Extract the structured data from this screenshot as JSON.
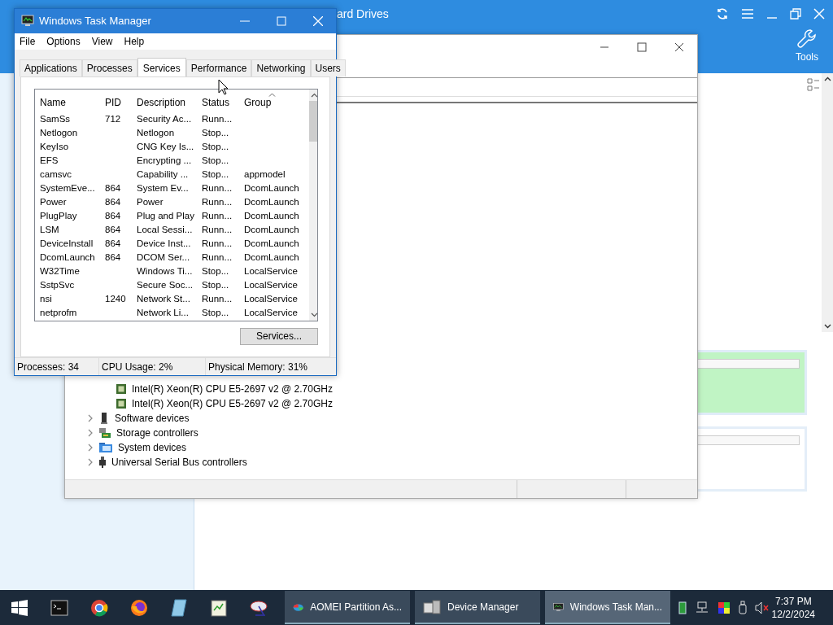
{
  "background_app": {
    "title": "ard Drives",
    "tools_label": "Tools"
  },
  "device_manager": {
    "tree": [
      {
        "kind": "cpu",
        "label": "Intel(R) Xeon(R) CPU E5-2697 v2 @ 2.70GHz"
      },
      {
        "kind": "cpu",
        "label": "Intel(R) Xeon(R) CPU E5-2697 v2 @ 2.70GHz"
      },
      {
        "kind": "software",
        "label": "Software devices",
        "expanded": false
      },
      {
        "kind": "storage",
        "label": "Storage controllers",
        "expanded": false
      },
      {
        "kind": "system",
        "label": "System devices",
        "expanded": false
      },
      {
        "kind": "usb",
        "label": "Universal Serial Bus controllers",
        "expanded": false
      }
    ]
  },
  "task_manager": {
    "title": "Windows Task Manager",
    "menu": [
      "File",
      "Options",
      "View",
      "Help"
    ],
    "tabs": [
      {
        "label": "Applications",
        "selected": false
      },
      {
        "label": "Processes",
        "selected": false
      },
      {
        "label": "Services",
        "selected": true
      },
      {
        "label": "Performance",
        "selected": false
      },
      {
        "label": "Networking",
        "selected": false
      },
      {
        "label": "Users",
        "selected": false
      }
    ],
    "columns": [
      {
        "label": "Name",
        "sorted": false
      },
      {
        "label": "PID",
        "sorted": false
      },
      {
        "label": "Description",
        "sorted": false
      },
      {
        "label": "Status",
        "sorted": false
      },
      {
        "label": "Group",
        "sorted": true
      }
    ],
    "rows": [
      [
        "SamSs",
        "712",
        "Security Ac...",
        "Runn...",
        ""
      ],
      [
        "Netlogon",
        "",
        "Netlogon",
        "Stop...",
        ""
      ],
      [
        "KeyIso",
        "",
        "CNG Key Is...",
        "Stop...",
        ""
      ],
      [
        "EFS",
        "",
        "Encrypting ...",
        "Stop...",
        ""
      ],
      [
        "camsvc",
        "",
        "Capability ...",
        "Stop...",
        "appmodel"
      ],
      [
        "SystemEve...",
        "864",
        "System Ev...",
        "Runn...",
        "DcomLaunch"
      ],
      [
        "Power",
        "864",
        "Power",
        "Runn...",
        "DcomLaunch"
      ],
      [
        "PlugPlay",
        "864",
        "Plug and Play",
        "Runn...",
        "DcomLaunch"
      ],
      [
        "LSM",
        "864",
        "Local Sessi...",
        "Runn...",
        "DcomLaunch"
      ],
      [
        "DeviceInstall",
        "864",
        "Device Inst...",
        "Runn...",
        "DcomLaunch"
      ],
      [
        "DcomLaunch",
        "864",
        "DCOM Ser...",
        "Runn...",
        "DcomLaunch"
      ],
      [
        "W32Time",
        "",
        "Windows Ti...",
        "Stop...",
        "LocalService"
      ],
      [
        "SstpSvc",
        "",
        "Secure Soc...",
        "Stop...",
        "LocalService"
      ],
      [
        "nsi",
        "1240",
        "Network St...",
        "Runn...",
        "LocalService"
      ],
      [
        "netprofm",
        "",
        "Network Li...",
        "Stop...",
        "LocalService"
      ]
    ],
    "services_button": "Services...",
    "status_bar": [
      "Processes: 34",
      "CPU Usage: 2%",
      "Physical Memory: 31%"
    ]
  },
  "taskbar": {
    "pinned": [
      {
        "kind": "terminal"
      },
      {
        "kind": "chrome"
      },
      {
        "kind": "firefox"
      },
      {
        "kind": "glass"
      },
      {
        "kind": "notepad"
      },
      {
        "kind": "dish"
      }
    ],
    "tasks": [
      {
        "kind": "aomei",
        "label": "AOMEI Partition As...",
        "selected": false
      },
      {
        "kind": "device",
        "label": "Device Manager",
        "selected": false
      },
      {
        "kind": "taskmgr",
        "label": "Windows Task Man...",
        "selected": true
      }
    ],
    "muted": true,
    "time": "7:37 PM",
    "date": "12/2/2024"
  }
}
